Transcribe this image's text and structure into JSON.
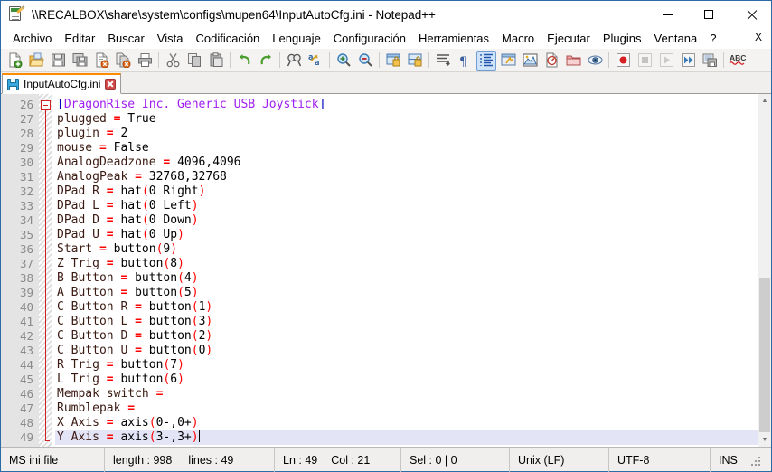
{
  "window": {
    "title": "\\\\RECALBOX\\share\\system\\configs\\mupen64\\InputAutoCfg.ini - Notepad++",
    "icon": "notepad-plus-plus-icon",
    "controls": {
      "minimize": "minimize-icon",
      "maximize": "maximize-icon",
      "close": "close-icon"
    }
  },
  "menubar": {
    "items": [
      "Archivo",
      "Editar",
      "Buscar",
      "Vista",
      "Codificación",
      "Lenguaje",
      "Configuración",
      "Herramientas",
      "Macro",
      "Ejecutar",
      "Plugins",
      "Ventana",
      "?"
    ],
    "close_doc": "X"
  },
  "toolbar": {
    "buttons": [
      {
        "name": "new-file-icon",
        "title": "Nuevo"
      },
      {
        "name": "open-file-icon",
        "title": "Abrir"
      },
      {
        "name": "save-icon",
        "title": "Guardar"
      },
      {
        "name": "save-all-icon",
        "title": "Guardar todo"
      },
      {
        "name": "close-file-icon",
        "title": "Cerrar"
      },
      {
        "name": "close-all-icon",
        "title": "Cerrar todo"
      },
      {
        "name": "print-icon",
        "title": "Imprimir"
      },
      {
        "name": "cut-icon",
        "title": "Cortar"
      },
      {
        "name": "copy-icon",
        "title": "Copiar"
      },
      {
        "name": "paste-icon",
        "title": "Pegar"
      },
      {
        "name": "undo-icon",
        "title": "Deshacer"
      },
      {
        "name": "redo-icon",
        "title": "Rehacer"
      },
      {
        "name": "find-icon",
        "title": "Buscar"
      },
      {
        "name": "replace-icon",
        "title": "Reemplazar"
      },
      {
        "name": "zoom-in-icon",
        "title": "Acercar"
      },
      {
        "name": "zoom-out-icon",
        "title": "Alejar"
      },
      {
        "name": "sync-vertical-icon",
        "title": "Sincronizar desplazamiento vertical"
      },
      {
        "name": "sync-horizontal-icon",
        "title": "Sincronizar desplazamiento horizontal"
      },
      {
        "name": "word-wrap-icon",
        "title": "Ajuste de línea"
      },
      {
        "name": "show-all-chars-icon",
        "title": "Mostrar todos los caracteres"
      },
      {
        "name": "indent-guide-icon",
        "title": "Guías de indentación"
      },
      {
        "name": "user-language-icon",
        "title": "Lenguaje definido por el usuario"
      },
      {
        "name": "document-map-icon",
        "title": "Mapa del documento"
      },
      {
        "name": "function-list-icon",
        "title": "Lista de funciones"
      },
      {
        "name": "folder-workspace-icon",
        "title": "Carpeta como espacio de trabajo"
      },
      {
        "name": "monitoring-icon",
        "title": "Monitorizar"
      },
      {
        "name": "macro-record-icon",
        "title": "Grabar macro"
      },
      {
        "name": "macro-stop-icon",
        "title": "Detener grabación"
      },
      {
        "name": "macro-play-icon",
        "title": "Reproducir macro"
      },
      {
        "name": "macro-multi-play-icon",
        "title": "Ejecutar macro varias veces"
      },
      {
        "name": "macro-save-icon",
        "title": "Guardar macro grabada"
      },
      {
        "name": "spell-check-icon",
        "title": "Corrector ortográfico"
      }
    ]
  },
  "tabs": [
    {
      "label": "InputAutoCfg.ini",
      "save_icon": "floppy-save-icon",
      "close_icon": "tab-close-icon",
      "active": true
    }
  ],
  "editor": {
    "first_line": 26,
    "current_line": 49,
    "caret_col": 21,
    "lines": [
      {
        "n": 26,
        "type": "section",
        "text": "[DragonRise Inc. Generic USB Joystick]",
        "fold": "start"
      },
      {
        "n": 27,
        "type": "pair",
        "key": "plugged",
        "value": "True"
      },
      {
        "n": 28,
        "type": "pair",
        "key": "plugin",
        "value": "2"
      },
      {
        "n": 29,
        "type": "pair",
        "key": "mouse",
        "value": "False"
      },
      {
        "n": 30,
        "type": "pair",
        "key": "AnalogDeadzone",
        "value": "4096,4096"
      },
      {
        "n": 31,
        "type": "pair",
        "key": "AnalogPeak",
        "value": "32768,32768"
      },
      {
        "n": 32,
        "type": "pair",
        "key": "DPad R",
        "value": "hat(0 Right)"
      },
      {
        "n": 33,
        "type": "pair",
        "key": "DPad L",
        "value": "hat(0 Left)"
      },
      {
        "n": 34,
        "type": "pair",
        "key": "DPad D",
        "value": "hat(0 Down)"
      },
      {
        "n": 35,
        "type": "pair",
        "key": "DPad U",
        "value": "hat(0 Up)"
      },
      {
        "n": 36,
        "type": "pair",
        "key": "Start",
        "value": "button(9)"
      },
      {
        "n": 37,
        "type": "pair",
        "key": "Z Trig",
        "value": "button(8)"
      },
      {
        "n": 38,
        "type": "pair",
        "key": "B Button",
        "value": "button(4)"
      },
      {
        "n": 39,
        "type": "pair",
        "key": "A Button",
        "value": "button(5)"
      },
      {
        "n": 40,
        "type": "pair",
        "key": "C Button R",
        "value": "button(1)"
      },
      {
        "n": 41,
        "type": "pair",
        "key": "C Button L",
        "value": "button(3)"
      },
      {
        "n": 42,
        "type": "pair",
        "key": "C Button D",
        "value": "button(2)"
      },
      {
        "n": 43,
        "type": "pair",
        "key": "C Button U",
        "value": "button(0)"
      },
      {
        "n": 44,
        "type": "pair",
        "key": "R Trig",
        "value": "button(7)"
      },
      {
        "n": 45,
        "type": "pair",
        "key": "L Trig",
        "value": "button(6)"
      },
      {
        "n": 46,
        "type": "pair",
        "key": "Mempak switch",
        "value": ""
      },
      {
        "n": 47,
        "type": "pair",
        "key": "Rumblepak",
        "value": ""
      },
      {
        "n": 48,
        "type": "pair",
        "key": "X Axis",
        "value": "axis(0-,0+)"
      },
      {
        "n": 49,
        "type": "pair",
        "key": "Y Axis",
        "value": "axis(3-,3+)",
        "fold": "end",
        "current": true,
        "caret": true
      }
    ]
  },
  "statusbar": {
    "doc_type": "MS ini file",
    "length_label": "length : 998",
    "lines_label": "lines : 49",
    "ln_label": "Ln : 49",
    "col_label": "Col : 21",
    "sel_label": "Sel : 0 | 0",
    "eol": "Unix (LF)",
    "encoding": "UTF-8",
    "insert_mode": "INS"
  },
  "colors": {
    "accent_tab": "#ff8c00",
    "section": "#a020f0",
    "bracket": "#0000c0",
    "equals": "#ff0000",
    "current_line_bg": "#e4e4f7",
    "gutter_bg": "#e4e4e4",
    "window_border": "#2a6ba8"
  }
}
